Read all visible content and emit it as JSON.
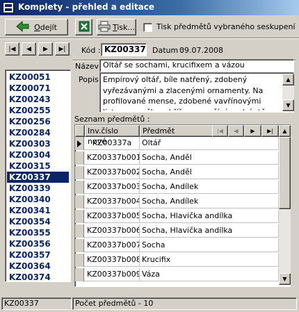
{
  "window": {
    "title": "Komplety - přehled a editace"
  },
  "toolbar": {
    "exit_label": "Odejít",
    "exit_underline": "O",
    "exit_rest": "dejít",
    "print_label": "Tisk...",
    "print_underline": "T",
    "print_rest": "isk...",
    "print_items_label": "Tisk předmětů vybraného seskupení"
  },
  "navigation": {
    "first": "|◀",
    "prev": "◀",
    "next": "▶",
    "last": "▶|"
  },
  "list": {
    "items": [
      "KZ00051",
      "KZ00071",
      "KZ00243",
      "KZ00255",
      "KZ00256",
      "KZ00284",
      "KZ00303",
      "KZ00304",
      "KZ00315",
      "KZ00337",
      "KZ00339",
      "KZ00340",
      "KZ00341",
      "KZ00354",
      "KZ00355",
      "KZ00356",
      "KZ00357",
      "KZ00364",
      "KZ00374"
    ],
    "selected": "KZ00337"
  },
  "detail": {
    "kod_label": "Kód :",
    "kod_value": "KZ00337",
    "datum_label": "Datum :",
    "datum_value": "09.07.2008",
    "nazev_label": "Název :",
    "nazev_value": "Oltář se sochami, krucifixem a vázou",
    "popis_label": "Popis :",
    "popis_value": "Empírový oltář, bíle natřený, zdobený vyřezávanými a zlacenými ornamenty. Na profilované mense, zdobené vavřínovými listy, zvonečky a křížem, spočívá zadní stěna, členěná kanelovanými korintskými pilastry, mezi"
  },
  "items_table": {
    "caption": "Seznam předmětů :",
    "columns": [
      "Inv.číslo nové",
      "Předmět"
    ],
    "rows": [
      [
        "KZ00337a",
        "Oltář"
      ],
      [
        "KZ00337b001",
        "Socha, Anděl"
      ],
      [
        "KZ00337b002",
        "Socha, Anděl"
      ],
      [
        "KZ00337b003",
        "Socha, Andílek"
      ],
      [
        "KZ00337b004",
        "Socha, Andílek"
      ],
      [
        "KZ00337b005",
        "Socha, Hlavička andílka"
      ],
      [
        "KZ00337b006",
        "Socha, Hlavička andílka"
      ],
      [
        "KZ00337b007",
        "Socha"
      ],
      [
        "KZ00337b008",
        "Krucifix"
      ],
      [
        "KZ00337b009",
        "Váza"
      ]
    ]
  },
  "status": {
    "left": "KZ00337",
    "right": "Počet předmětů - 10"
  },
  "colors": {
    "title_bar": "#0a246a",
    "selection": "#0a246a",
    "list_text": "#0a246a",
    "face": "#d4d0c8"
  }
}
